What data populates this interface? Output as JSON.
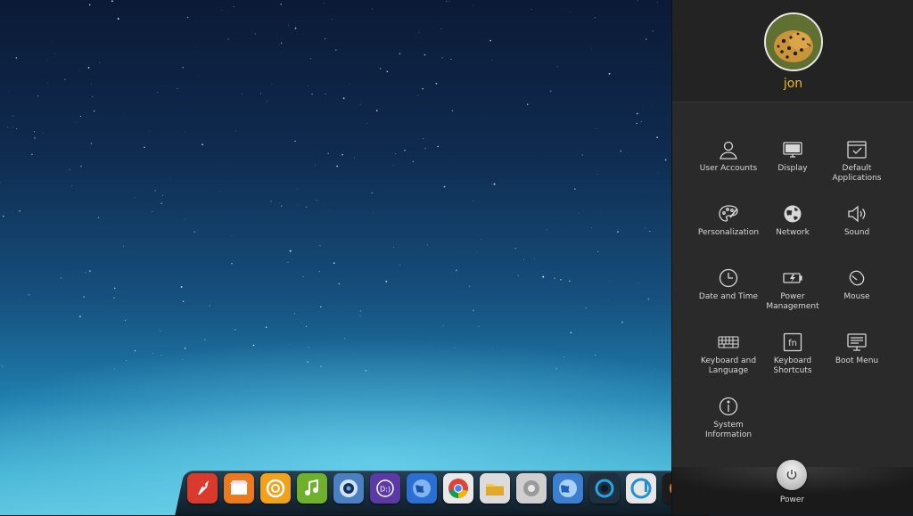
{
  "user": {
    "name": "jon"
  },
  "settings": [
    {
      "label": "User Accounts",
      "icon": "user-icon"
    },
    {
      "label": "Display",
      "icon": "monitor-icon"
    },
    {
      "label": "Default Applications",
      "icon": "default-apps-icon"
    },
    {
      "label": "Personalization",
      "icon": "palette-icon"
    },
    {
      "label": "Network",
      "icon": "globe-icon"
    },
    {
      "label": "Sound",
      "icon": "speaker-icon"
    },
    {
      "label": "Date and Time",
      "icon": "clock-icon"
    },
    {
      "label": "Power Management",
      "icon": "battery-icon"
    },
    {
      "label": "Mouse",
      "icon": "mouse-icon"
    },
    {
      "label": "Keyboard and Language",
      "icon": "keyboard-icon"
    },
    {
      "label": "Keyboard Shortcuts",
      "icon": "fn-key-icon"
    },
    {
      "label": "Boot Menu",
      "icon": "boot-menu-icon"
    },
    {
      "label": "System Information",
      "icon": "info-icon"
    }
  ],
  "power": {
    "label": "Power",
    "icon": "power-icon"
  },
  "dock": [
    {
      "name": "launcher",
      "color": "#d93a2b",
      "icon": "rocket-icon"
    },
    {
      "name": "store",
      "color": "#ec7a1c",
      "icon": "store-icon"
    },
    {
      "name": "browser-app",
      "color": "#f2a21a",
      "icon": "swirl-icon"
    },
    {
      "name": "music-player",
      "color": "#6fb12c",
      "icon": "music-note-icon"
    },
    {
      "name": "camera",
      "color": "#4a7fc1",
      "icon": "camera-icon"
    },
    {
      "name": "translator",
      "color": "#5b3aa8",
      "icon": "translate-icon"
    },
    {
      "name": "web-browser",
      "color": "#2a6fd1",
      "icon": "globe-browser-icon"
    },
    {
      "name": "chrome",
      "color": "#e9e9e9",
      "icon": "chrome-icon"
    },
    {
      "name": "file-manager",
      "color": "#dcdcdc",
      "icon": "folder-icon"
    },
    {
      "name": "system-settings",
      "color": "#cfcfcf",
      "icon": "gear-icon"
    },
    {
      "name": "network-manager",
      "color": "#3c7fd0",
      "icon": "network-globe-icon"
    },
    {
      "name": "media-player",
      "color": "#1f2f3f",
      "icon": "media-ring-icon"
    },
    {
      "name": "deepin-music",
      "color": "#e6e6e6",
      "icon": "d-logo-icon"
    },
    {
      "name": "partial-app",
      "color": "#1c1c1c",
      "icon": "app-icon"
    }
  ]
}
